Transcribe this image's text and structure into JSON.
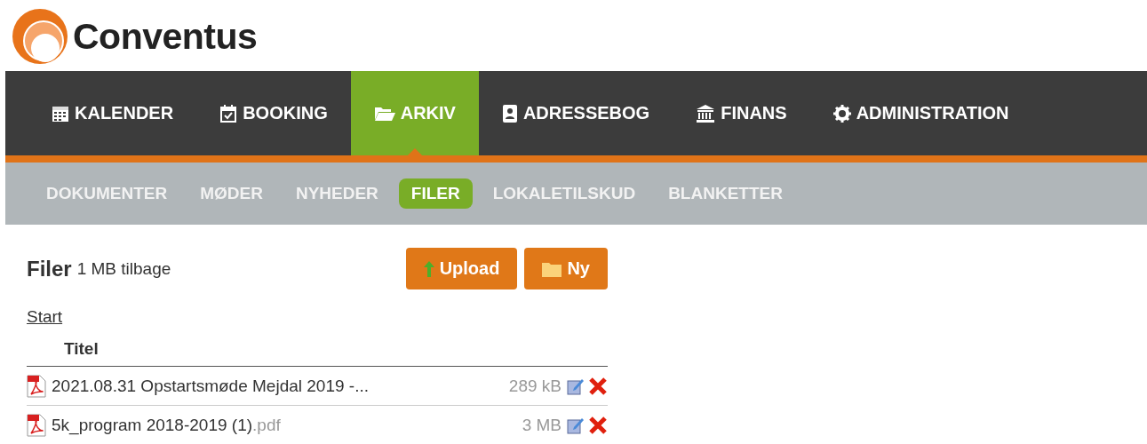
{
  "logo": {
    "text": "Conventus"
  },
  "main_nav": [
    {
      "label": "KALENDER",
      "kind": "calendar",
      "selected": false
    },
    {
      "label": "BOOKING",
      "kind": "booking",
      "selected": false
    },
    {
      "label": "ARKIV",
      "kind": "folder",
      "selected": true
    },
    {
      "label": "ADRESSEBOG",
      "kind": "contacts",
      "selected": false
    },
    {
      "label": "FINANS",
      "kind": "bank",
      "selected": false
    },
    {
      "label": "ADMINISTRATION",
      "kind": "gear",
      "selected": false
    }
  ],
  "sub_nav": [
    {
      "label": "DOKUMENTER",
      "selected": false
    },
    {
      "label": "MØDER",
      "selected": false
    },
    {
      "label": "NYHEDER",
      "selected": false
    },
    {
      "label": "FILER",
      "selected": true
    },
    {
      "label": "LOKALETILSKUD",
      "selected": false
    },
    {
      "label": "BLANKETTER",
      "selected": false
    }
  ],
  "files": {
    "title": "Filer",
    "quota": "1 MB tilbage",
    "buttons": [
      {
        "label": "Upload",
        "kind": "upload"
      },
      {
        "label": "Ny",
        "kind": "folder"
      }
    ],
    "breadcrumb": "Start",
    "column": "Titel",
    "rows": [
      {
        "name": "2021.08.31 Opstartsmøde Mejdal 2019 -...",
        "size": "289 kB"
      },
      {
        "name": "5k_program 2018-2019 (1)",
        "extension": ".pdf",
        "size": "3 MB"
      }
    ]
  }
}
